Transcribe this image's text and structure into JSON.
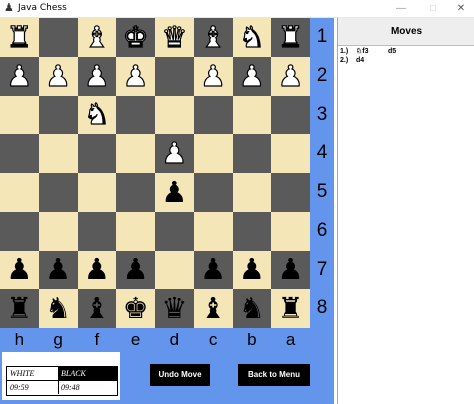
{
  "window": {
    "title": "Java Chess",
    "minimize_glyph": "—",
    "maximize_glyph": "□",
    "close_glyph": "✕",
    "icon_glyph": "♟"
  },
  "board": {
    "light_color": "#f5e6b8",
    "dark_color": "#5a5a5a",
    "rows": [
      [
        "wR",
        "",
        "wB",
        "wK",
        "wQ",
        "wB",
        "wN",
        "wR"
      ],
      [
        "wP",
        "wP",
        "wP",
        "wP",
        "",
        "wP",
        "wP",
        "wP"
      ],
      [
        "",
        "",
        "wN",
        "",
        "",
        "",
        "",
        ""
      ],
      [
        "",
        "",
        "",
        "",
        "wP",
        "",
        "",
        ""
      ],
      [
        "",
        "",
        "",
        "",
        "bP",
        "",
        "",
        ""
      ],
      [
        "",
        "",
        "",
        "",
        "",
        "",
        "",
        ""
      ],
      [
        "bP",
        "bP",
        "bP",
        "bP",
        "",
        "bP",
        "bP",
        "bP"
      ],
      [
        "bR",
        "bN",
        "bB",
        "bK",
        "bQ",
        "bB",
        "bN",
        "bR"
      ]
    ],
    "rank_labels": [
      "1",
      "2",
      "3",
      "4",
      "5",
      "6",
      "7",
      "8"
    ],
    "file_labels": [
      "h",
      "g",
      "f",
      "e",
      "d",
      "c",
      "b",
      "a"
    ]
  },
  "clock": {
    "white_label": "WHITE",
    "black_label": "BLACK",
    "white_time": "09:59",
    "black_time": "09:48"
  },
  "buttons": {
    "undo_label": "Undo Move",
    "menu_label": "Back to Menu"
  },
  "moves": {
    "title": "Moves",
    "list": [
      {
        "num": "1.)",
        "white": "♘f3",
        "black": "d5"
      },
      {
        "num": "2.)",
        "white": "d4",
        "black": ""
      }
    ]
  },
  "colors": {
    "panel_blue": "#6495ed"
  }
}
